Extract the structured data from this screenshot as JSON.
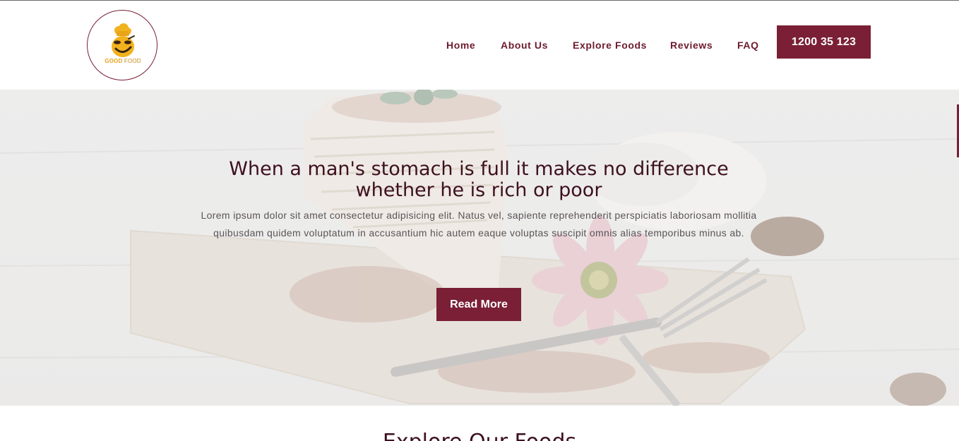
{
  "brand": {
    "logo_word1": "GOOD",
    "logo_word2": "FOOD",
    "accent_color": "#7a1f35"
  },
  "nav": {
    "items": [
      {
        "label": "Home"
      },
      {
        "label": "About Us"
      },
      {
        "label": "Explore Foods"
      },
      {
        "label": "Reviews"
      },
      {
        "label": "FAQ"
      }
    ],
    "phone": "1200 35 123"
  },
  "hero": {
    "title_line1": "When a man's stomach is full it makes no difference",
    "title_line2": "whether he is rich or poor",
    "text": "Lorem ipsum dolor sit amet consectetur adipisicing elit. Natus vel, sapiente reprehenderit perspiciatis laboriosam mollitia quibusdam quidem voluptatum in accusantium hic autem eaque voluptas suscipit omnis alias temporibus minus ab.",
    "button": "Read More"
  },
  "section": {
    "title": "Explore Our Foods"
  }
}
